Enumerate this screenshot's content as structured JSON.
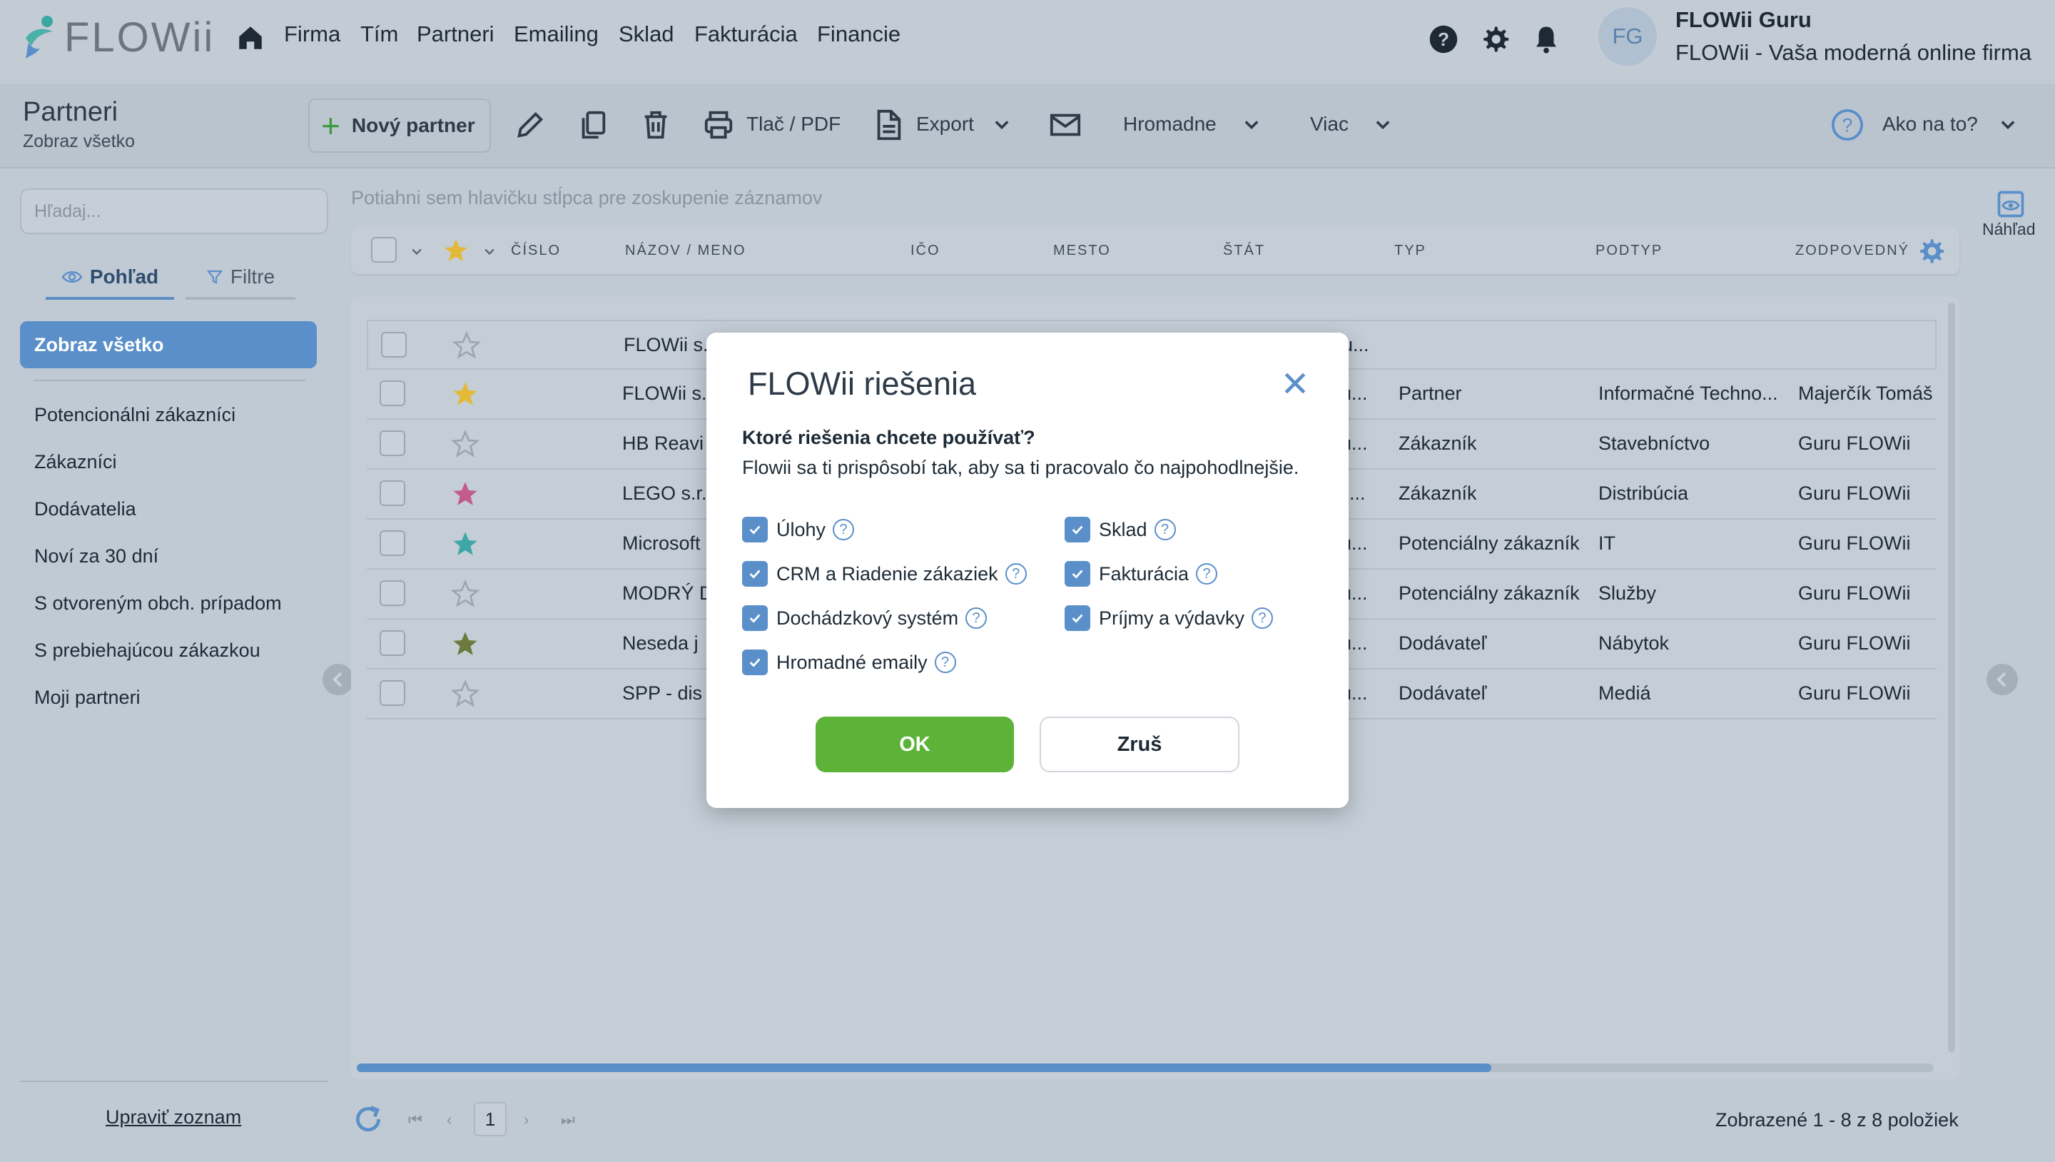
{
  "app": {
    "logo_text": "FLOWii",
    "nav": [
      "Firma",
      "Tím",
      "Partneri",
      "Emailing",
      "Sklad",
      "Fakturácia",
      "Financie"
    ],
    "user": {
      "initials": "FG",
      "name": "FLOWii Guru",
      "company": "FLOWii - Vaša moderná online firma"
    }
  },
  "toolbar": {
    "title": "Partneri",
    "subtitle": "Zobraz všetko",
    "new_partner": "Nový partner",
    "print": "Tlač / PDF",
    "export": "Export",
    "bulk": "Hromadne",
    "more": "Viac",
    "help": "Ako na to?"
  },
  "sidebar": {
    "search_placeholder": "Hľadaj...",
    "tab_view": "Pohľad",
    "tab_filters": "Filtre",
    "active_view": "Zobraz všetko",
    "views": [
      "Potencionálni zákazníci",
      "Zákazníci",
      "Dodávatelia",
      "Noví za 30 dní",
      "S otvoreným obch. prípadom",
      "S prebiehajúcou zákazkou",
      "Moji partneri"
    ],
    "edit_list": "Upraviť zoznam"
  },
  "grid": {
    "group_hint": "Potiahni sem hlavičku stĺpca pre zoskupenie záznamov",
    "columns": [
      "ČÍSLO",
      "NÁZOV / MENO",
      "IČO",
      "MESTO",
      "ŠTÁT",
      "TYP",
      "PODTYP",
      "ZODPOVEDNÝ"
    ],
    "rows": [
      {
        "star": "empty",
        "star_color": "#9aa6b1",
        "name": "FLOWii s.",
        "state": "ou...",
        "type": "",
        "subtype": "",
        "owner": ""
      },
      {
        "star": "filled",
        "star_color": "#e3b93a",
        "name": "FLOWii s.",
        "state": "ou...",
        "type": "Partner",
        "subtype": "Informačné Techno...",
        "owner": "Majerčík Tomáš"
      },
      {
        "star": "empty",
        "star_color": "#9aa6b1",
        "name": "HB Reavi",
        "state": "ou...",
        "type": "Zákazník",
        "subtype": "Stavebníctvo",
        "owner": "Guru FLOWii"
      },
      {
        "star": "filled",
        "star_color": "#c35c8e",
        "name": "LEGO s.r.",
        "state": "ys...",
        "type": "Zákazník",
        "subtype": "Distribúcia",
        "owner": "Guru FLOWii"
      },
      {
        "star": "filled",
        "star_color": "#3fa7a7",
        "name": "Microsoft",
        "state": "ou...",
        "type": "Potenciálny zákazník",
        "subtype": "IT",
        "owner": "Guru FLOWii"
      },
      {
        "star": "empty",
        "star_color": "#9aa6b1",
        "name": "MODRÝ D",
        "state": "ou...",
        "type": "Potenciálny zákazník",
        "subtype": "Služby",
        "owner": "Guru FLOWii"
      },
      {
        "star": "filled",
        "star_color": "#6d7a3e",
        "name": "Neseda j",
        "state": "ou...",
        "type": "Dodávateľ",
        "subtype": "Nábytok",
        "owner": "Guru FLOWii"
      },
      {
        "star": "empty",
        "star_color": "#9aa6b1",
        "name": "SPP - dis",
        "state": "ou...",
        "type": "Dodávateľ",
        "subtype": "Mediá",
        "owner": "Guru FLOWii"
      }
    ],
    "preview_label": "Náhľad"
  },
  "footer": {
    "current_page": "1",
    "count": "Zobrazené 1 - 8 z 8 položiek"
  },
  "modal": {
    "title": "FLOWii riešenia",
    "question": "Ktoré riešenia chcete používať?",
    "description": "Flowii sa ti prispôsobí tak, aby sa ti pracovalo čo najpohodlnejšie.",
    "options": [
      {
        "label": "Úlohy",
        "checked": true
      },
      {
        "label": "Sklad",
        "checked": true
      },
      {
        "label": "CRM a Riadenie zákaziek",
        "checked": true
      },
      {
        "label": "Fakturácia",
        "checked": true
      },
      {
        "label": "Dochádzkový systém",
        "checked": true
      },
      {
        "label": "Príjmy a výdavky",
        "checked": true
      },
      {
        "label": "Hromadné emaily",
        "checked": true
      }
    ],
    "ok": "OK",
    "cancel": "Zruš"
  },
  "colors": {
    "accent": "#5a8fc9",
    "ok_green": "#5cb338",
    "overlay_bg": "#c0cad4"
  }
}
